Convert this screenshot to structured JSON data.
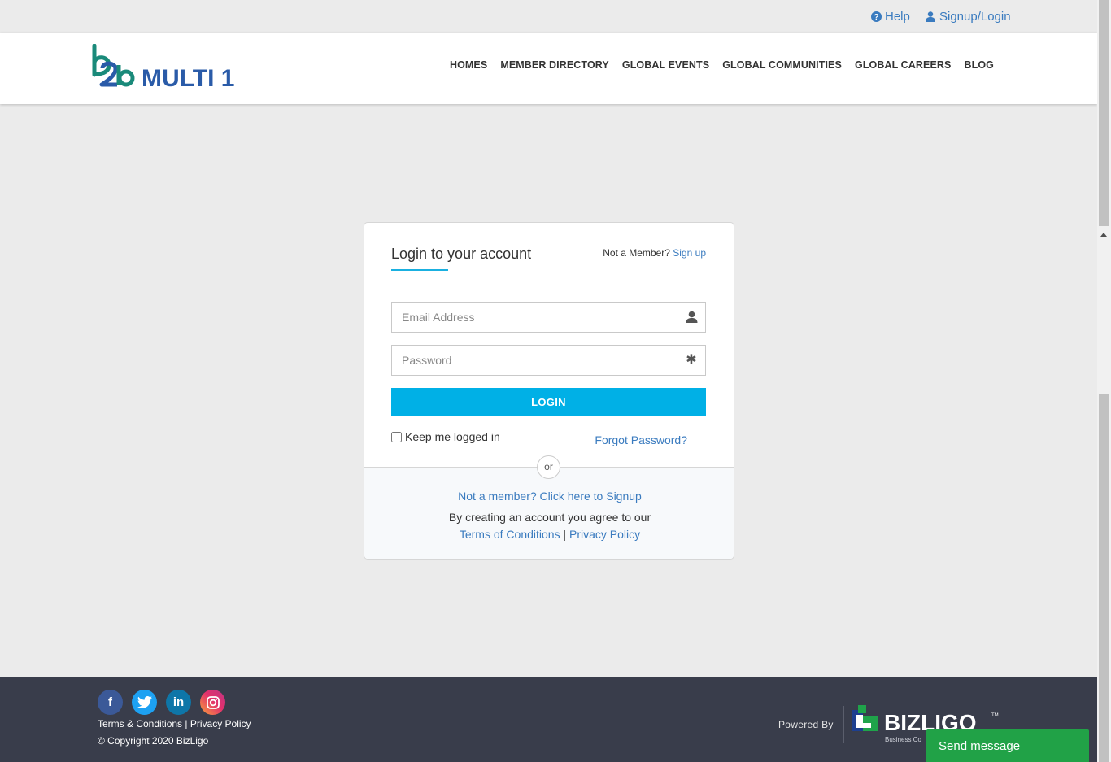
{
  "topbar": {
    "help_label": "Help",
    "signup_login_label": "Signup/Login"
  },
  "header": {
    "logo_mark": "b2b",
    "logo_text": "MULTI 1",
    "nav": [
      "HOMES",
      "MEMBER DIRECTORY",
      "GLOBAL EVENTS",
      "GLOBAL COMMUNITIES",
      "GLOBAL CAREERS",
      "BLOG"
    ]
  },
  "login": {
    "title": "Login to your account",
    "not_member_text": "Not a Member?",
    "sign_up_link": "Sign up",
    "email_placeholder": "Email Address",
    "password_placeholder": "Password",
    "login_button": "LOGIN",
    "keep_logged_in": "Keep me logged in",
    "forgot_password": "Forgot Password?",
    "or_label": "or",
    "signup_cta": "Not a member? Click here to Signup",
    "agree_text": "By creating an account you agree to our",
    "terms_link": "Terms of Conditions",
    "separator": "|",
    "privacy_link": "Privacy Policy"
  },
  "footer": {
    "socials": [
      "facebook",
      "twitter",
      "linkedin",
      "instagram"
    ],
    "terms_link": "Terms & Conditions",
    "separator": "|",
    "privacy_link": "Privacy Policy",
    "copyright": "© Copyright 2020 BizLigo",
    "powered_by": "Powered By",
    "brand": "BIZLIGO",
    "brand_tm": "TM",
    "brand_tagline": "Business Co"
  },
  "chat": {
    "send_message": "Send message"
  },
  "colors": {
    "accent": "#00b0e6",
    "link": "#3a7bbf",
    "footer_bg": "#393d4b",
    "chat_green": "#21a247",
    "logo_teal": "#1a8a7a",
    "logo_blue": "#2a5ba8"
  }
}
